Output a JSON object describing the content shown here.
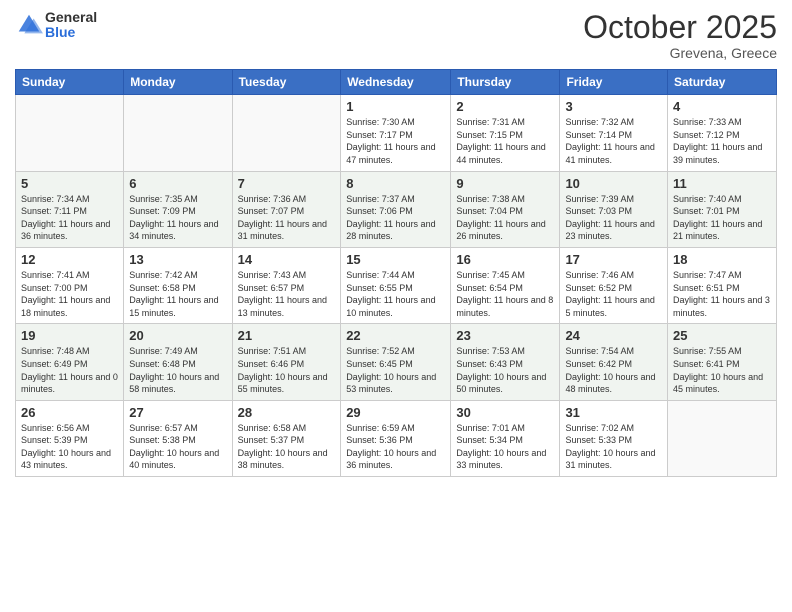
{
  "header": {
    "logo_general": "General",
    "logo_blue": "Blue",
    "month": "October 2025",
    "location": "Grevena, Greece"
  },
  "days_of_week": [
    "Sunday",
    "Monday",
    "Tuesday",
    "Wednesday",
    "Thursday",
    "Friday",
    "Saturday"
  ],
  "weeks": [
    [
      {
        "day": "",
        "info": ""
      },
      {
        "day": "",
        "info": ""
      },
      {
        "day": "",
        "info": ""
      },
      {
        "day": "1",
        "info": "Sunrise: 7:30 AM\nSunset: 7:17 PM\nDaylight: 11 hours and 47 minutes."
      },
      {
        "day": "2",
        "info": "Sunrise: 7:31 AM\nSunset: 7:15 PM\nDaylight: 11 hours and 44 minutes."
      },
      {
        "day": "3",
        "info": "Sunrise: 7:32 AM\nSunset: 7:14 PM\nDaylight: 11 hours and 41 minutes."
      },
      {
        "day": "4",
        "info": "Sunrise: 7:33 AM\nSunset: 7:12 PM\nDaylight: 11 hours and 39 minutes."
      }
    ],
    [
      {
        "day": "5",
        "info": "Sunrise: 7:34 AM\nSunset: 7:11 PM\nDaylight: 11 hours and 36 minutes."
      },
      {
        "day": "6",
        "info": "Sunrise: 7:35 AM\nSunset: 7:09 PM\nDaylight: 11 hours and 34 minutes."
      },
      {
        "day": "7",
        "info": "Sunrise: 7:36 AM\nSunset: 7:07 PM\nDaylight: 11 hours and 31 minutes."
      },
      {
        "day": "8",
        "info": "Sunrise: 7:37 AM\nSunset: 7:06 PM\nDaylight: 11 hours and 28 minutes."
      },
      {
        "day": "9",
        "info": "Sunrise: 7:38 AM\nSunset: 7:04 PM\nDaylight: 11 hours and 26 minutes."
      },
      {
        "day": "10",
        "info": "Sunrise: 7:39 AM\nSunset: 7:03 PM\nDaylight: 11 hours and 23 minutes."
      },
      {
        "day": "11",
        "info": "Sunrise: 7:40 AM\nSunset: 7:01 PM\nDaylight: 11 hours and 21 minutes."
      }
    ],
    [
      {
        "day": "12",
        "info": "Sunrise: 7:41 AM\nSunset: 7:00 PM\nDaylight: 11 hours and 18 minutes."
      },
      {
        "day": "13",
        "info": "Sunrise: 7:42 AM\nSunset: 6:58 PM\nDaylight: 11 hours and 15 minutes."
      },
      {
        "day": "14",
        "info": "Sunrise: 7:43 AM\nSunset: 6:57 PM\nDaylight: 11 hours and 13 minutes."
      },
      {
        "day": "15",
        "info": "Sunrise: 7:44 AM\nSunset: 6:55 PM\nDaylight: 11 hours and 10 minutes."
      },
      {
        "day": "16",
        "info": "Sunrise: 7:45 AM\nSunset: 6:54 PM\nDaylight: 11 hours and 8 minutes."
      },
      {
        "day": "17",
        "info": "Sunrise: 7:46 AM\nSunset: 6:52 PM\nDaylight: 11 hours and 5 minutes."
      },
      {
        "day": "18",
        "info": "Sunrise: 7:47 AM\nSunset: 6:51 PM\nDaylight: 11 hours and 3 minutes."
      }
    ],
    [
      {
        "day": "19",
        "info": "Sunrise: 7:48 AM\nSunset: 6:49 PM\nDaylight: 11 hours and 0 minutes."
      },
      {
        "day": "20",
        "info": "Sunrise: 7:49 AM\nSunset: 6:48 PM\nDaylight: 10 hours and 58 minutes."
      },
      {
        "day": "21",
        "info": "Sunrise: 7:51 AM\nSunset: 6:46 PM\nDaylight: 10 hours and 55 minutes."
      },
      {
        "day": "22",
        "info": "Sunrise: 7:52 AM\nSunset: 6:45 PM\nDaylight: 10 hours and 53 minutes."
      },
      {
        "day": "23",
        "info": "Sunrise: 7:53 AM\nSunset: 6:43 PM\nDaylight: 10 hours and 50 minutes."
      },
      {
        "day": "24",
        "info": "Sunrise: 7:54 AM\nSunset: 6:42 PM\nDaylight: 10 hours and 48 minutes."
      },
      {
        "day": "25",
        "info": "Sunrise: 7:55 AM\nSunset: 6:41 PM\nDaylight: 10 hours and 45 minutes."
      }
    ],
    [
      {
        "day": "26",
        "info": "Sunrise: 6:56 AM\nSunset: 5:39 PM\nDaylight: 10 hours and 43 minutes."
      },
      {
        "day": "27",
        "info": "Sunrise: 6:57 AM\nSunset: 5:38 PM\nDaylight: 10 hours and 40 minutes."
      },
      {
        "day": "28",
        "info": "Sunrise: 6:58 AM\nSunset: 5:37 PM\nDaylight: 10 hours and 38 minutes."
      },
      {
        "day": "29",
        "info": "Sunrise: 6:59 AM\nSunset: 5:36 PM\nDaylight: 10 hours and 36 minutes."
      },
      {
        "day": "30",
        "info": "Sunrise: 7:01 AM\nSunset: 5:34 PM\nDaylight: 10 hours and 33 minutes."
      },
      {
        "day": "31",
        "info": "Sunrise: 7:02 AM\nSunset: 5:33 PM\nDaylight: 10 hours and 31 minutes."
      },
      {
        "day": "",
        "info": ""
      }
    ]
  ]
}
